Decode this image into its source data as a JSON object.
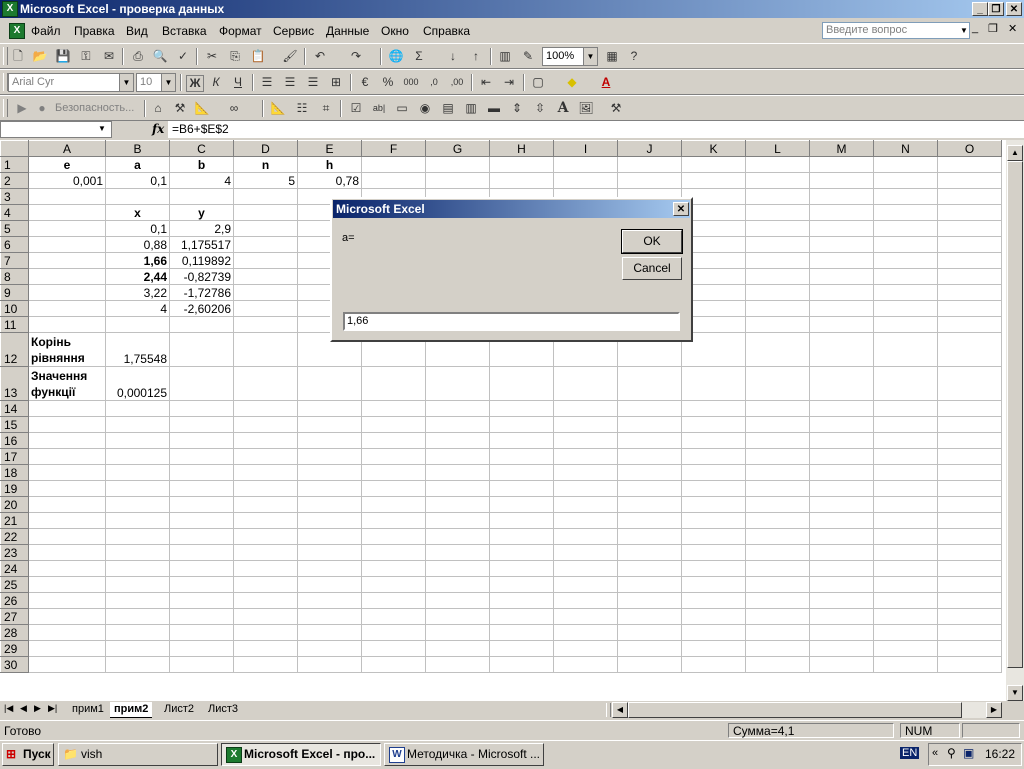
{
  "window": {
    "title": "Microsoft Excel - проверка данных"
  },
  "menu": {
    "items": [
      "Файл",
      "Правка",
      "Вид",
      "Вставка",
      "Формат",
      "Сервис",
      "Данные",
      "Окно",
      "Справка"
    ],
    "ask_placeholder": "Введите вопрос"
  },
  "toolbar": {
    "zoom": "100%",
    "font": "Arial Cyr",
    "size": "10",
    "security": "Безопасность..."
  },
  "formula_bar": {
    "name_box": "",
    "fx": "fx",
    "formula": "=B6+$E$2"
  },
  "columns": [
    "A",
    "B",
    "C",
    "D",
    "E",
    "F",
    "G",
    "H",
    "I",
    "J",
    "K",
    "L",
    "M",
    "N",
    "O"
  ],
  "rows": [
    [
      "1",
      "e",
      "a",
      "b",
      "n",
      "h"
    ],
    [
      "2",
      "0,001",
      "0,1",
      "4",
      "5",
      "0,78"
    ],
    [
      "3",
      "",
      "",
      "",
      "",
      ""
    ],
    [
      "4",
      "",
      "x",
      "y",
      "",
      ""
    ],
    [
      "5",
      "",
      "0,1",
      "2,9",
      "",
      ""
    ],
    [
      "6",
      "",
      "0,88",
      "1,175517",
      "",
      ""
    ],
    [
      "7",
      "",
      "1,66",
      "0,119892",
      "",
      ""
    ],
    [
      "8",
      "",
      "2,44",
      "-0,82739",
      "",
      ""
    ],
    [
      "9",
      "",
      "3,22",
      "-1,72786",
      "",
      ""
    ],
    [
      "10",
      "",
      "4",
      "-2,60206",
      "",
      ""
    ],
    [
      "11",
      "",
      "",
      "",
      "",
      ""
    ],
    [
      "12",
      "Корінь рівняння",
      "1,75548",
      "",
      "",
      ""
    ],
    [
      "13",
      "Значення функції",
      "0,000125",
      "",
      "",
      ""
    ],
    [
      "14",
      "",
      "",
      "",
      "",
      ""
    ],
    [
      "15",
      "",
      "",
      "",
      "",
      ""
    ],
    [
      "16",
      "",
      "",
      "",
      "",
      ""
    ],
    [
      "17",
      "",
      "",
      "",
      "",
      ""
    ],
    [
      "18",
      "",
      "",
      "",
      "",
      ""
    ],
    [
      "19",
      "",
      "",
      "",
      "",
      ""
    ],
    [
      "20",
      "",
      "",
      "",
      "",
      ""
    ],
    [
      "21",
      "",
      "",
      "",
      "",
      ""
    ],
    [
      "22",
      "",
      "",
      "",
      "",
      ""
    ],
    [
      "23",
      "",
      "",
      "",
      "",
      ""
    ],
    [
      "24",
      "",
      "",
      "",
      "",
      ""
    ],
    [
      "25",
      "",
      "",
      "",
      "",
      ""
    ],
    [
      "26",
      "",
      "",
      "",
      "",
      ""
    ],
    [
      "27",
      "",
      "",
      "",
      "",
      ""
    ],
    [
      "28",
      "",
      "",
      "",
      "",
      ""
    ],
    [
      "29",
      "",
      "",
      "",
      "",
      ""
    ],
    [
      "30",
      "",
      "",
      "",
      "",
      ""
    ]
  ],
  "sheets": [
    "прим1",
    "прим2",
    "Лист2",
    "Лист3"
  ],
  "active_sheet": "прим2",
  "status": {
    "ready": "Готово",
    "sum": "Сумма=4,1",
    "num": "NUM"
  },
  "dialog": {
    "title": "Microsoft Excel",
    "prompt": "a=",
    "ok": "OK",
    "cancel": "Cancel",
    "value": "1,66"
  },
  "taskbar": {
    "start": "Пуск",
    "items": [
      "vish",
      "Microsoft Excel - про...",
      "Методичка - Microsoft ..."
    ],
    "lang": "EN",
    "time": "16:22"
  },
  "colors": {
    "title_start": "#0a246a",
    "title_end": "#a6caf0",
    "face": "#d4d0c8"
  }
}
